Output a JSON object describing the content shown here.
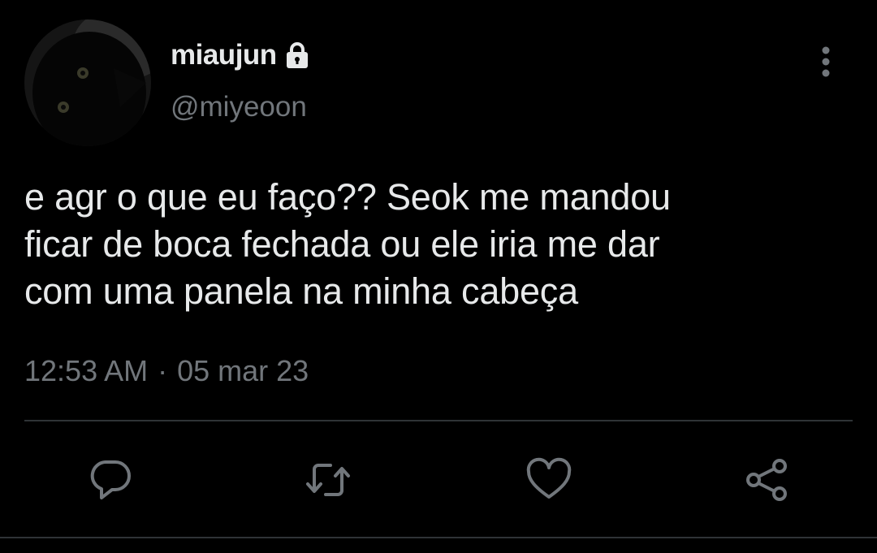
{
  "tweet": {
    "author": {
      "display_name": "miaujun",
      "handle": "@miyeoon",
      "avatar_icon": "black-cat-avatar",
      "protected_icon": "lock-icon"
    },
    "text": "e agr o que eu faço?? Seok me mandou\nficar de boca fechada ou ele iria me dar\ncom uma panela na minha cabeça",
    "time": "12:53 AM",
    "separator": "·",
    "date": "05 mar 23"
  },
  "actions": [
    {
      "name": "reply",
      "icon": "reply-icon"
    },
    {
      "name": "retweet",
      "icon": "retweet-icon"
    },
    {
      "name": "like",
      "icon": "heart-icon"
    },
    {
      "name": "share",
      "icon": "share-icon"
    }
  ],
  "colors": {
    "background": "#000000",
    "text_primary": "#e7e9ea",
    "text_secondary": "#71767b",
    "divider": "#2f3336"
  }
}
